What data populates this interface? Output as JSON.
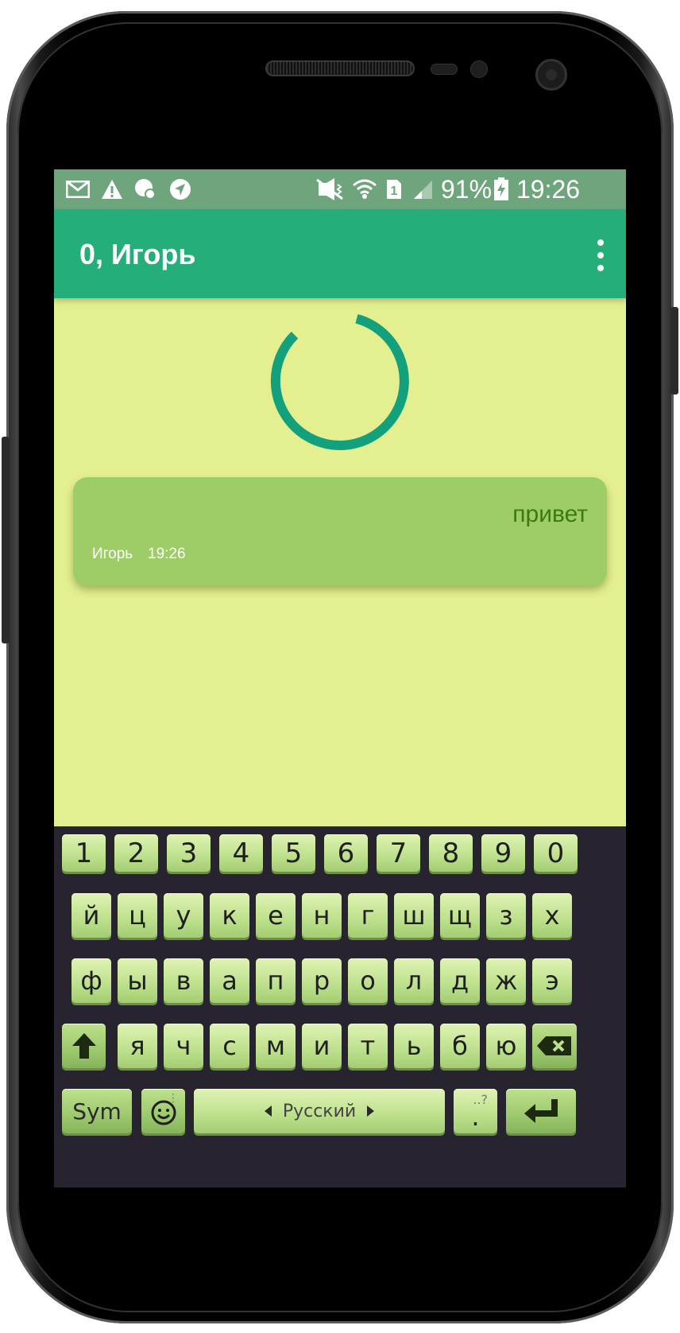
{
  "status_bar": {
    "battery_percent": "91%",
    "time": "19:26",
    "sim_slot": "1",
    "icons": [
      "mail-icon",
      "warning-icon",
      "chat-bubble-icon",
      "navigation-icon",
      "mute-icon",
      "wifi-icon",
      "sim-icon",
      "signal-icon",
      "battery-charging-icon"
    ]
  },
  "app_bar": {
    "title": "0, Игорь",
    "menu_icon": "more-vert-icon",
    "color": "#26ae7a"
  },
  "loading": {
    "indicator": "progress-spinner",
    "color": "#13a07c"
  },
  "messages": [
    {
      "text": "привет",
      "author": "Игорь",
      "time": "19:26"
    }
  ],
  "keyboard": {
    "numbers": [
      "1",
      "2",
      "3",
      "4",
      "5",
      "6",
      "7",
      "8",
      "9",
      "0"
    ],
    "row1": [
      "й",
      "ц",
      "у",
      "к",
      "е",
      "н",
      "г",
      "ш",
      "щ",
      "з",
      "х"
    ],
    "row2": [
      "ф",
      "ы",
      "в",
      "а",
      "п",
      "р",
      "о",
      "л",
      "д",
      "ж",
      "э"
    ],
    "row3": [
      "я",
      "ч",
      "с",
      "м",
      "и",
      "т",
      "ь",
      "б",
      "ю"
    ],
    "sym_label": "Sym",
    "language_label": "Русский",
    "period_label": ".",
    "period_hint": "..?",
    "shift_icon": "shift-arrow-icon",
    "backspace_icon": "backspace-icon",
    "emoji_icon": "smiley-icon",
    "enter_icon": "enter-icon"
  },
  "colors": {
    "screen_bg": "#e4ef90",
    "status_bar": "#6ea57c",
    "bubble": "#9ecd67",
    "bubble_text": "#3b7a10",
    "keyboard_bg": "#27232f"
  }
}
